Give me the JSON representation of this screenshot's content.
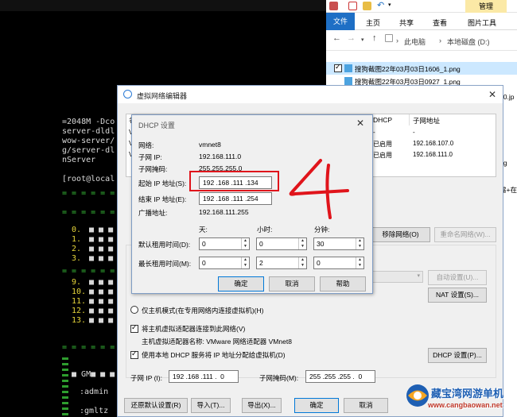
{
  "terminal": {
    "lines": [
      "=2048M -Dco",
      "server-dldl",
      "wow-server/",
      "g/server-dl",
      "nServer"
    ],
    "prompt": "[root@local",
    "menu_numbers": [
      "0.",
      "1.",
      "2.",
      "3.",
      "9.",
      "10.",
      "11.",
      "12.",
      "13."
    ],
    "gm_label": "GM",
    "admin_label": ":admin",
    "gmltz_label": ":gmltz"
  },
  "explorer": {
    "ribbon_manage": "管理",
    "tabs": {
      "file": "文件",
      "home": "主页",
      "share": "共享",
      "view": "查看",
      "picture_tools": "图片工具"
    },
    "breadcrumb": [
      "此电脑",
      "本地磁盘 (D:)"
    ],
    "files": [
      "搜狗截图22年03月03日1606_1.png",
      "搜狗截图22年03月03日0927_1.png"
    ],
    "right_fragments": [
      "90.jp",
      "ng",
      "需+在"
    ]
  },
  "vne": {
    "title": "虚拟网络编辑器",
    "table_headers": {
      "dhcp": "DHCP",
      "subnet": "子网地址"
    },
    "rows": [
      {
        "dhcp": "-",
        "subnet": "-"
      },
      {
        "dhcp": "已启用",
        "subnet": "192.168.107.0"
      },
      {
        "dhcp": "已启用",
        "subnet": "192.168.111.0"
      }
    ],
    "partial_left": [
      "名",
      "V",
      "V",
      "V"
    ],
    "remove_network": "移除网络(O)",
    "rename_network": "重命名网络(W)...",
    "auto_setting": "自动设置(U)...",
    "nat_setting": "NAT 设置(S)...",
    "host_only_radio": "仅主机模式(在专用网络内连接虚拟机)(H)",
    "connect_adapter_checkbox": "将主机虚拟适配器连接到此网络(V)",
    "adapter_name_label": "主机虚拟适配器名称: VMware 网络适配器 VMnet8",
    "use_dhcp_checkbox": "使用本地 DHCP 服务将 IP 地址分配给虚拟机(D)",
    "dhcp_settings_button": "DHCP 设置(P)...",
    "subnet_ip_label": "子网 IP (I):",
    "subnet_ip_value": "192 .168 .111 .  0",
    "subnet_mask_label": "子网掩码(M):",
    "subnet_mask_value": "255 .255 .255 .  0",
    "restore_default": "还原默认设置(R)",
    "import": "导入(T)...",
    "export": "导出(X)...",
    "ok": "确定",
    "cancel": "取消"
  },
  "dhcp": {
    "title": "DHCP 设置",
    "network_label": "网络:",
    "network_value": "vmnet8",
    "subnet_ip_label": "子网 IP:",
    "subnet_ip_value": "192.168.111.0",
    "subnet_mask_label": "子网掩码:",
    "subnet_mask_value": "255.255.255.0",
    "start_ip_label": "起始 IP 地址(S):",
    "start_ip_value": "192 .168 .111 .134",
    "end_ip_label": "结束 IP 地址(E):",
    "end_ip_value": "192 .168 .111 .254",
    "broadcast_label": "广播地址:",
    "broadcast_value": "192.168.111.255",
    "col_days": "天:",
    "col_hours": "小时:",
    "col_minutes": "分钟:",
    "default_lease_label": "默认租用时间(D):",
    "default_lease": [
      "0",
      "0",
      "30"
    ],
    "max_lease_label": "最长租用时间(M):",
    "max_lease": [
      "0",
      "2",
      "0"
    ],
    "ok": "确定",
    "cancel": "取消",
    "help": "帮助"
  },
  "annotation": {
    "handwritten_number": "4"
  },
  "watermark": {
    "title": "藏宝湾网游单机",
    "url": "www.cangbaowan.net"
  }
}
